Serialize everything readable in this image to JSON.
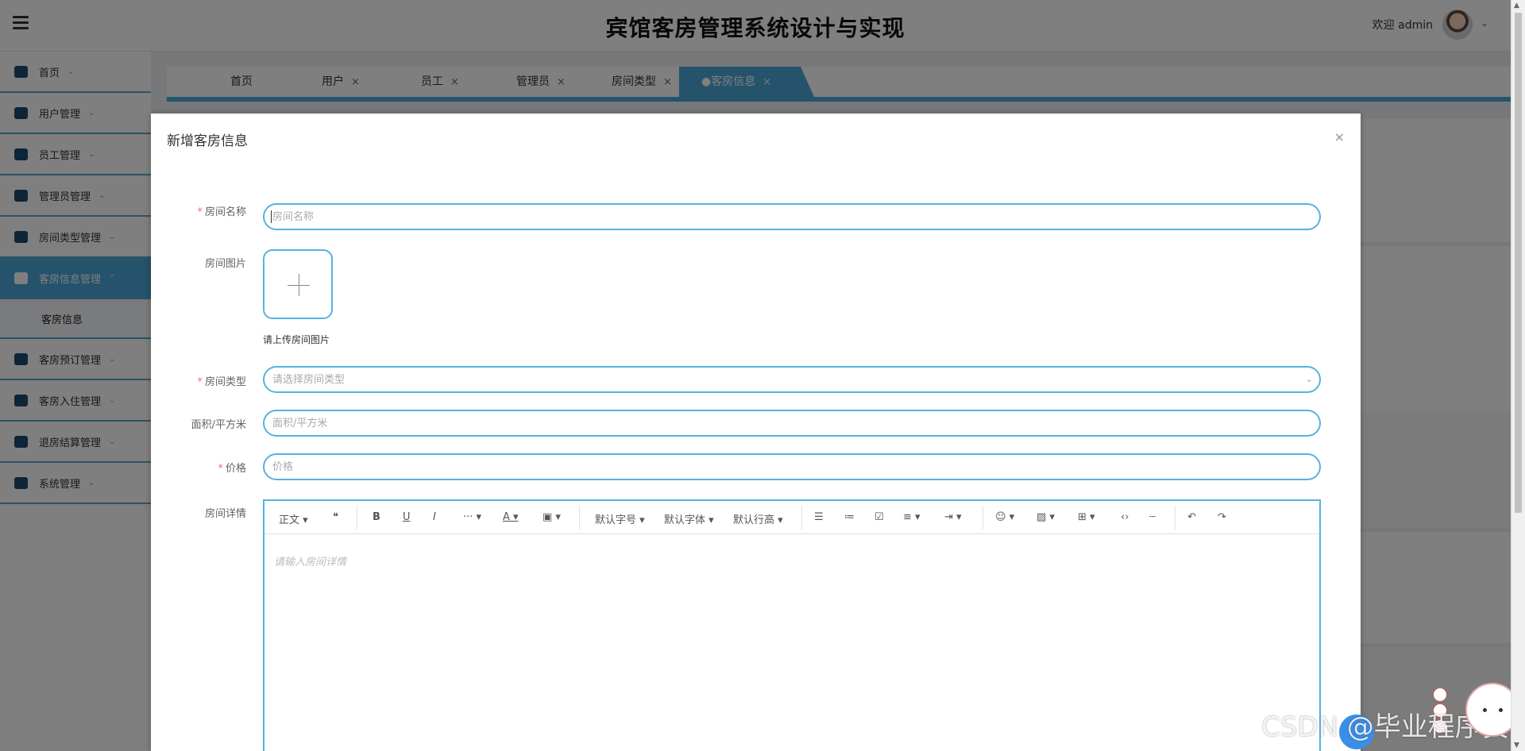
{
  "header": {
    "system_title": "宾馆客房管理系统设计与实现",
    "welcome_text": "欢迎 admin"
  },
  "sidebar": {
    "items": [
      {
        "label": "首页",
        "icon": "home-icon"
      },
      {
        "label": "用户管理",
        "icon": "user-icon"
      },
      {
        "label": "员工管理",
        "icon": "staff-icon"
      },
      {
        "label": "管理员管理",
        "icon": "admin-icon"
      },
      {
        "label": "房间类型管理",
        "icon": "room-type-icon"
      },
      {
        "label": "客房信息管理",
        "icon": "room-info-icon",
        "active": true
      },
      {
        "label": "客房预订管理",
        "icon": "booking-icon"
      },
      {
        "label": "客房入住管理",
        "icon": "checkin-icon"
      },
      {
        "label": "退房结算管理",
        "icon": "checkout-icon"
      },
      {
        "label": "系统管理",
        "icon": "system-icon"
      }
    ],
    "submenu_label": "客房信息"
  },
  "tabs": [
    {
      "label": "首页"
    },
    {
      "label": "用户",
      "close": "×"
    },
    {
      "label": "员工",
      "close": "×"
    },
    {
      "label": "管理员",
      "close": "×"
    },
    {
      "label": "房间类型",
      "close": "×"
    },
    {
      "label": "●客房信息",
      "close": "×",
      "active": true
    }
  ],
  "modal": {
    "title": "新增客房信息",
    "close": "×",
    "fields": {
      "room_name": {
        "label": "房间名称",
        "placeholder": "房间名称",
        "required": true
      },
      "room_image": {
        "label": "房间图片",
        "upload_hint": "请上传房间图片"
      },
      "room_type": {
        "label": "房间类型",
        "placeholder": "请选择房间类型",
        "required": true
      },
      "area": {
        "label": "面积/平方米",
        "placeholder": "面积/平方米"
      },
      "price": {
        "label": "价格",
        "placeholder": "价格",
        "required": true
      },
      "details": {
        "label": "房间详情",
        "placeholder": "请输入房间详情"
      }
    },
    "editor_toolbar": {
      "heading": "正文",
      "font_size": "默认字号",
      "font_family": "默认字体",
      "line_height": "默认行高"
    }
  },
  "watermark": "CSDN @毕业程序员",
  "colors": {
    "accent": "#4ba6d8",
    "input_border": "#55b2df",
    "required_mark": "#f56c6c"
  }
}
